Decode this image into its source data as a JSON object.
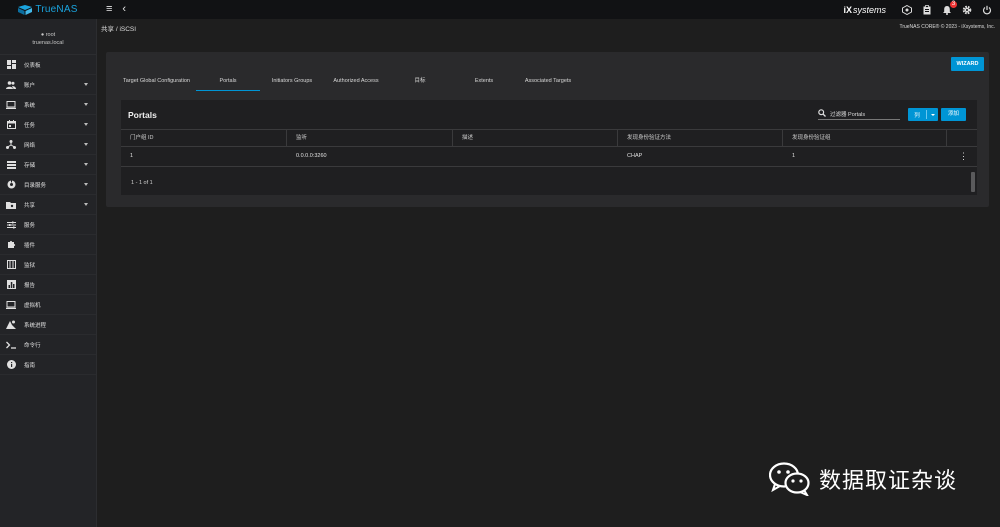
{
  "topbar": {
    "logo_main": "TrueNAS",
    "logo_sub": "core",
    "menu_glyph": "≡",
    "back_glyph": "‹",
    "brand_ix": "iX",
    "brand_systems": "systems",
    "notification_count": "3",
    "icons": [
      "truecommand-icon",
      "clipboard-icon",
      "bell-icon",
      "gear-icon",
      "power-icon"
    ]
  },
  "sidebar": {
    "user_name": "root",
    "hostname": "truenas.local",
    "items": [
      {
        "label": "仪表板",
        "icon": "dashboard-icon",
        "expandable": false
      },
      {
        "label": "账户",
        "icon": "accounts-icon",
        "expandable": true
      },
      {
        "label": "系统",
        "icon": "system-icon",
        "expandable": true
      },
      {
        "label": "任务",
        "icon": "calendar-icon",
        "expandable": true
      },
      {
        "label": "网络",
        "icon": "network-icon",
        "expandable": true
      },
      {
        "label": "存储",
        "icon": "storage-icon",
        "expandable": true
      },
      {
        "label": "目录服务",
        "icon": "directory-icon",
        "expandable": true
      },
      {
        "label": "共享",
        "icon": "shares-icon",
        "expandable": true
      },
      {
        "label": "服务",
        "icon": "services-icon",
        "expandable": false
      },
      {
        "label": "插件",
        "icon": "plugins-icon",
        "expandable": false
      },
      {
        "label": "监狱",
        "icon": "jails-icon",
        "expandable": false
      },
      {
        "label": "报告",
        "icon": "reporting-icon",
        "expandable": false
      },
      {
        "label": "虚拟机",
        "icon": "vm-icon",
        "expandable": false
      },
      {
        "label": "系统进程",
        "icon": "processes-icon",
        "expandable": false
      },
      {
        "label": "命令行",
        "icon": "shell-icon",
        "expandable": false
      },
      {
        "label": "指南",
        "icon": "guide-icon",
        "expandable": false
      }
    ]
  },
  "breadcrumb": {
    "parent": "共享",
    "separator": "/",
    "current": "iSCSI"
  },
  "copyright": "TrueNAS CORE® © 2023 - iXsystems, Inc.",
  "wizard_label": "WIZARD",
  "tabs": [
    {
      "label": "Target Global Configuration",
      "active": false
    },
    {
      "label": "Portals",
      "active": true
    },
    {
      "label": "Initiators Groups",
      "active": false
    },
    {
      "label": "Authorized Access",
      "active": false
    },
    {
      "label": "目标",
      "active": false
    },
    {
      "label": "Extents",
      "active": false
    },
    {
      "label": "Associated Targets",
      "active": false
    }
  ],
  "portals": {
    "title": "Portals",
    "search_placeholder": "过滤器 Portals",
    "columns_button": "列",
    "add_button": "添加",
    "headers": [
      "门户组 ID",
      "监听",
      "描述",
      "发现身份验证方法",
      "发现身份验证组"
    ],
    "rows": [
      [
        "1",
        "0.0.0.0:3260",
        "",
        "CHAP",
        "1"
      ]
    ],
    "pager": "1 - 1 of 1"
  },
  "watermark": "数据取证杂谈",
  "colors": {
    "accent": "#0095d5",
    "background": "#1e1e1e",
    "card": "#2a2a2c"
  }
}
